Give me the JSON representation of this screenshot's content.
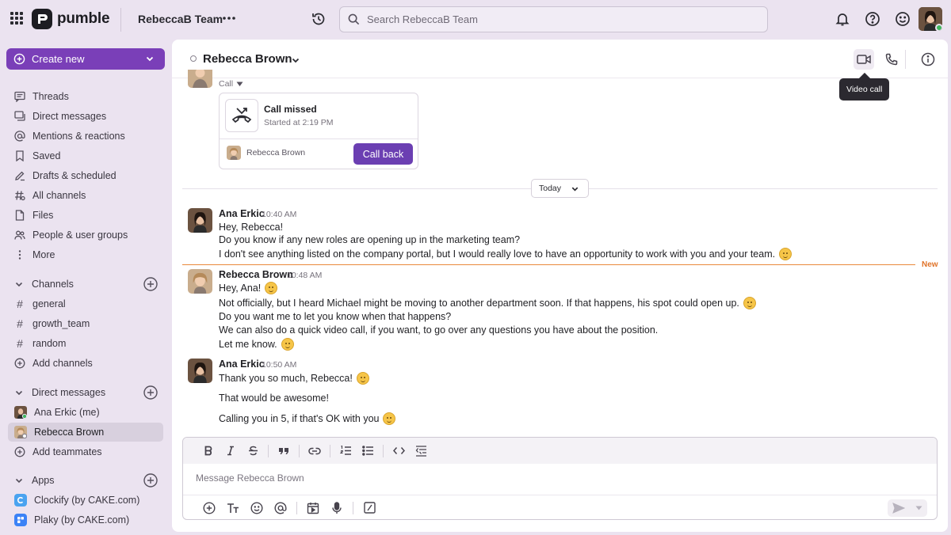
{
  "app": {
    "brand": "pumble",
    "team": "RebeccaB Team"
  },
  "search": {
    "placeholder": "Search RebeccaB Team"
  },
  "sidebar": {
    "create_new": "Create new",
    "nav": [
      {
        "label": "Threads",
        "icon": "threads-icon"
      },
      {
        "label": "Direct messages",
        "icon": "direct-messages-icon"
      },
      {
        "label": "Mentions & reactions",
        "icon": "mention-icon"
      },
      {
        "label": "Saved",
        "icon": "bookmark-icon"
      },
      {
        "label": "Drafts & scheduled",
        "icon": "drafts-icon"
      },
      {
        "label": "All channels",
        "icon": "all-channels-icon"
      },
      {
        "label": "Files",
        "icon": "files-icon"
      },
      {
        "label": "People & user groups",
        "icon": "people-icon"
      },
      {
        "label": "More",
        "icon": "more-vertical-icon"
      }
    ],
    "channels_header": "Channels",
    "channels": [
      "general",
      "growth_team",
      "random"
    ],
    "add_channels": "Add channels",
    "dm_header": "Direct messages",
    "dms": [
      "Ana Erkic (me)",
      "Rebecca Brown"
    ],
    "add_teammates": "Add teammates",
    "apps_header": "Apps",
    "apps": [
      {
        "label": "Clockify (by CAKE.com)",
        "color": "#4aa3f0"
      },
      {
        "label": "Plaky (by CAKE.com)",
        "color": "#3b82f6"
      }
    ]
  },
  "conversation": {
    "title": "Rebecca Brown",
    "tooltip": "Video call",
    "call_label": "Call",
    "call_card": {
      "title": "Call missed",
      "subtitle": "Started at 2:19 PM",
      "caller": "Rebecca Brown",
      "button": "Call back"
    },
    "date_divider": "Today",
    "new_label": "New",
    "messages": [
      {
        "author": "Ana Erkic",
        "time": "10:40 AM",
        "lines": [
          "Hey, Rebecca!",
          "Do you know if any new roles are opening up in the marketing team?",
          "I don't see anything listed on the company portal, but I would really love to have an opportunity to work with you and your team."
        ]
      },
      {
        "author": "Rebecca Brown",
        "time": "10:48 AM",
        "lines": [
          "Hey, Ana!",
          "Not officially, but I heard Michael might be moving to another department soon. If that happens, his spot could open up.",
          "Do you want me to let you know when that happens?",
          "We can also do a quick video call, if you want, to go over any questions you have about the position.",
          "Let me know."
        ]
      },
      {
        "author": "Ana Erkic",
        "time": "10:50 AM",
        "lines": [
          "Thank you so much, Rebecca!",
          "That would be awesome!",
          "Calling you in 5, if that's OK with you"
        ]
      }
    ]
  },
  "composer": {
    "placeholder": "Message Rebecca Brown"
  },
  "colors": {
    "accent": "#7a3fb8",
    "call_back": "#6b3fb2",
    "new_rule": "#e9883c"
  }
}
